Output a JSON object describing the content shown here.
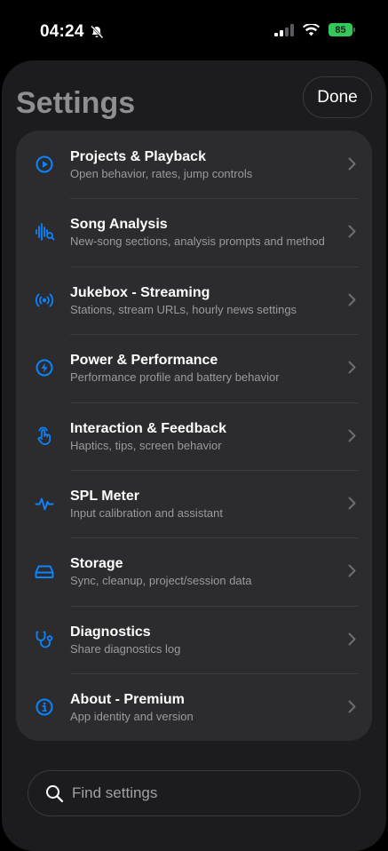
{
  "status_bar": {
    "time": "04:24",
    "battery": "85"
  },
  "header": {
    "title": "Settings",
    "done_label": "Done"
  },
  "settings": [
    {
      "title": "Projects & Playback",
      "subtitle": "Open behavior, rates, jump controls",
      "icon": "play-circle-icon"
    },
    {
      "title": "Song Analysis",
      "subtitle": "New-song sections, analysis prompts and method",
      "icon": "waveform-search-icon"
    },
    {
      "title": "Jukebox - Streaming",
      "subtitle": "Stations, stream URLs, hourly news settings",
      "icon": "broadcast-icon"
    },
    {
      "title": "Power & Performance",
      "subtitle": "Performance profile and battery behavior",
      "icon": "bolt-circle-icon"
    },
    {
      "title": "Interaction & Feedback",
      "subtitle": "Haptics, tips, screen behavior",
      "icon": "hand-tap-icon"
    },
    {
      "title": "SPL Meter",
      "subtitle": "Input calibration and assistant",
      "icon": "waveform-pulse-icon"
    },
    {
      "title": "Storage",
      "subtitle": "Sync, cleanup, project/session data",
      "icon": "drive-icon"
    },
    {
      "title": "Diagnostics",
      "subtitle": "Share diagnostics log",
      "icon": "stethoscope-icon"
    },
    {
      "title": "About - Premium",
      "subtitle": "App identity and version",
      "icon": "info-circle-icon"
    }
  ],
  "search": {
    "placeholder": "Find settings",
    "value": ""
  },
  "colors": {
    "accent": "#0a84ff",
    "background": "#000000",
    "sheet": "#1c1c1e",
    "card": "#2c2c2e",
    "battery": "#34c759"
  }
}
